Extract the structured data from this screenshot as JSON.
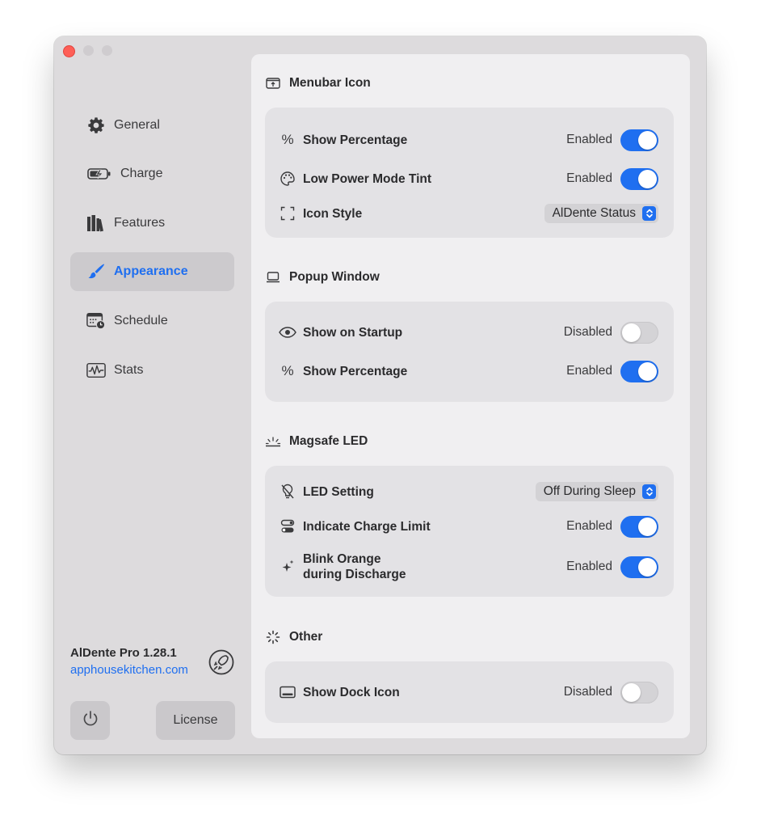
{
  "sidebar": {
    "items": [
      {
        "label": "General",
        "icon": "gear-icon"
      },
      {
        "label": "Charge",
        "icon": "battery-icon"
      },
      {
        "label": "Features",
        "icon": "books-icon"
      },
      {
        "label": "Appearance",
        "icon": "paintbrush-icon",
        "active": true
      },
      {
        "label": "Schedule",
        "icon": "calendar-clock-icon"
      },
      {
        "label": "Stats",
        "icon": "waveform-icon"
      }
    ],
    "version": "AlDente Pro 1.28.1",
    "website": "apphousekitchen.com",
    "license_label": "License"
  },
  "sections": {
    "menubar": {
      "title": "Menubar Icon",
      "rows": [
        {
          "label": "Show Percentage",
          "state": "Enabled"
        },
        {
          "label": "Low Power Mode Tint",
          "state": "Enabled"
        },
        {
          "label": "Icon Style",
          "value": "AlDente Status"
        }
      ]
    },
    "popup": {
      "title": "Popup Window",
      "rows": [
        {
          "label": "Show on Startup",
          "state": "Disabled"
        },
        {
          "label": "Show Percentage",
          "state": "Enabled"
        }
      ]
    },
    "magsafe": {
      "title": "Magsafe LED",
      "rows": [
        {
          "label": "LED Setting",
          "value": "Off During Sleep"
        },
        {
          "label": "Indicate Charge Limit",
          "state": "Enabled"
        },
        {
          "label_line1": "Blink Orange",
          "label_line2": "during Discharge",
          "state": "Enabled"
        }
      ]
    },
    "other": {
      "title": "Other",
      "rows": [
        {
          "label": "Show Dock Icon",
          "state": "Disabled"
        }
      ]
    }
  },
  "colors": {
    "accent": "#1f6ff0",
    "window_bg": "#dddbdd",
    "panel_bg": "#f0eff1",
    "card_bg": "#e3e2e5",
    "close": "#fe5f57"
  }
}
